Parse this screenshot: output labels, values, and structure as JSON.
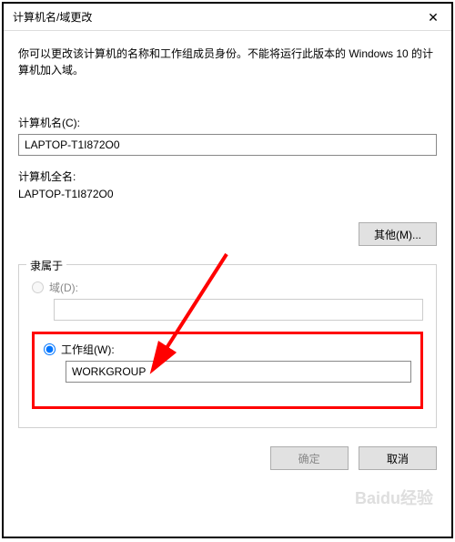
{
  "window": {
    "title": "计算机名/域更改",
    "close_icon": "✕"
  },
  "description": "你可以更改该计算机的名称和工作组成员身份。不能将运行此版本的 Windows 10 的计算机加入域。",
  "computer_name": {
    "label": "计算机名(C):",
    "value": "LAPTOP-T1I872O0"
  },
  "full_name": {
    "label": "计算机全名:",
    "value": "LAPTOP-T1I872O0"
  },
  "other_button": "其他(M)...",
  "membership": {
    "legend": "隶属于",
    "domain": {
      "label": "域(D):",
      "value": ""
    },
    "workgroup": {
      "label": "工作组(W):",
      "value": "WORKGROUP"
    }
  },
  "buttons": {
    "ok": "确定",
    "cancel": "取消"
  },
  "watermark": "Baidu经验",
  "annotation": {
    "highlight_color": "#ff0000"
  }
}
